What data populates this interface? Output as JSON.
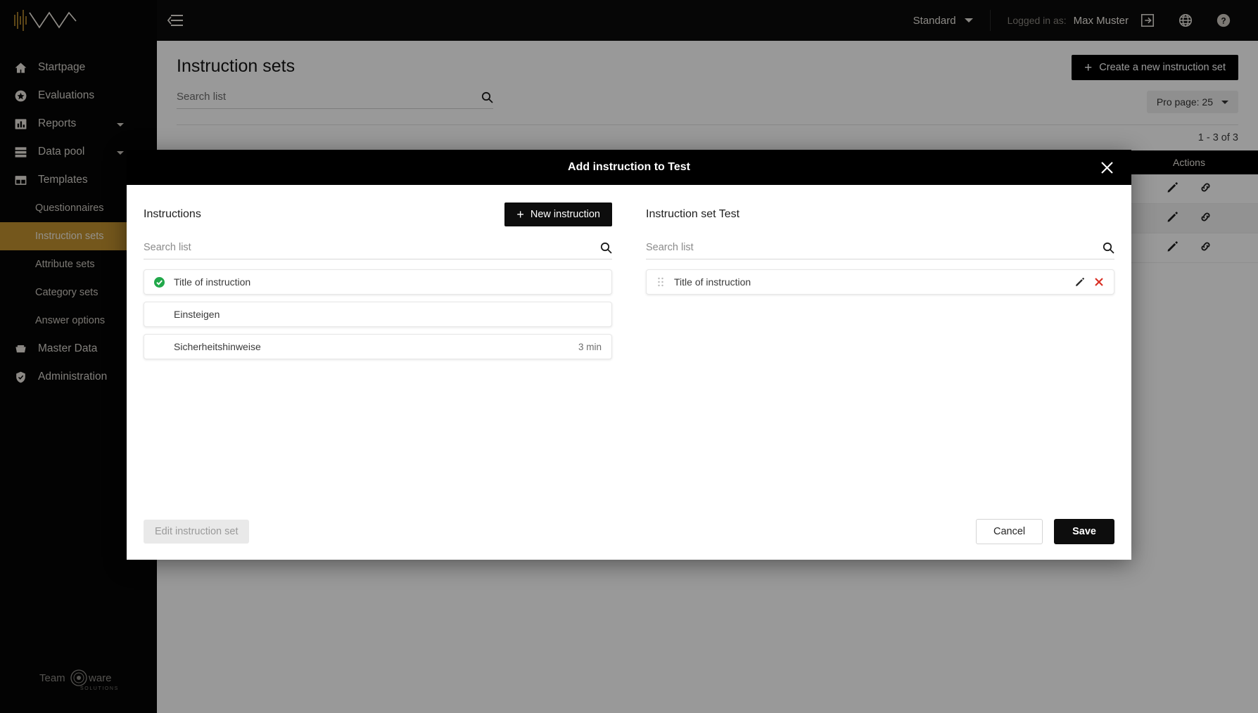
{
  "sidebar": {
    "logo_name": "wave-logo",
    "items": [
      {
        "label": "Startpage",
        "icon": "home-icon",
        "has_chevron": false,
        "level": 0,
        "active": false
      },
      {
        "label": "Evaluations",
        "icon": "star-icon",
        "has_chevron": false,
        "level": 0,
        "active": false
      },
      {
        "label": "Reports",
        "icon": "bar-chart-icon",
        "has_chevron": true,
        "level": 0,
        "active": false
      },
      {
        "label": "Data pool",
        "icon": "list-icon",
        "has_chevron": true,
        "level": 0,
        "active": false
      },
      {
        "label": "Templates",
        "icon": "templates-icon",
        "has_chevron": false,
        "level": 0,
        "active": false
      },
      {
        "label": "Questionnaires",
        "icon": "",
        "has_chevron": false,
        "level": 1,
        "active": false
      },
      {
        "label": "Instruction sets",
        "icon": "",
        "has_chevron": false,
        "level": 1,
        "active": true
      },
      {
        "label": "Attribute sets",
        "icon": "",
        "has_chevron": false,
        "level": 1,
        "active": false
      },
      {
        "label": "Category sets",
        "icon": "",
        "has_chevron": false,
        "level": 1,
        "active": false
      },
      {
        "label": "Answer options",
        "icon": "",
        "has_chevron": false,
        "level": 1,
        "active": false
      },
      {
        "label": "Master Data",
        "icon": "inbox-icon",
        "has_chevron": false,
        "level": 0,
        "active": false
      },
      {
        "label": "Administration",
        "icon": "shield-check-icon",
        "has_chevron": false,
        "level": 0,
        "active": false
      }
    ],
    "footer_brand_main": "Team",
    "footer_brand_second": "ware",
    "footer_brand_sub": "SOLUTIONS",
    "active_color": "#c1912f"
  },
  "topbar": {
    "collapse_icon": "collapse-sidebar-icon",
    "env_label": "Standard",
    "logged_in_label": "Logged in as:",
    "user_name": "Max Muster",
    "icons": [
      "logout-icon",
      "globe-icon",
      "help-icon"
    ]
  },
  "page": {
    "title": "Instruction sets",
    "search_placeholder": "Search list",
    "search_value": "",
    "create_button": "Create a new instruction set",
    "per_page_label": "Pro page: 25",
    "range_label": "1 - 3 of 3",
    "table": {
      "columns": [
        "Actions"
      ],
      "rows": [
        {
          "actions": [
            "edit-icon",
            "link-icon"
          ]
        },
        {
          "actions": [
            "edit-icon",
            "link-icon"
          ]
        },
        {
          "actions": [
            "edit-icon",
            "link-icon"
          ]
        }
      ]
    }
  },
  "modal": {
    "title": "Add instruction to Test",
    "close_icon": "close-icon",
    "left_panel": {
      "title": "Instructions",
      "new_button": "New instruction",
      "search_placeholder": "Search list",
      "search_value": "",
      "items": [
        {
          "label": "Title of instruction",
          "selected": true,
          "meta": ""
        },
        {
          "label": "Einsteigen",
          "selected": false,
          "meta": ""
        },
        {
          "label": "Sicherheitshinweise",
          "selected": false,
          "meta": "3 min"
        }
      ]
    },
    "right_panel": {
      "title": "Instruction set Test",
      "search_placeholder": "Search list",
      "search_value": "",
      "items": [
        {
          "label": "Title of instruction"
        }
      ]
    },
    "footer": {
      "edit_set_button": "Edit instruction set",
      "cancel_button": "Cancel",
      "save_button": "Save"
    }
  },
  "colors": {
    "accent": "#c1912f",
    "success": "#21a84a",
    "danger": "#d93025",
    "dark": "#000000"
  }
}
